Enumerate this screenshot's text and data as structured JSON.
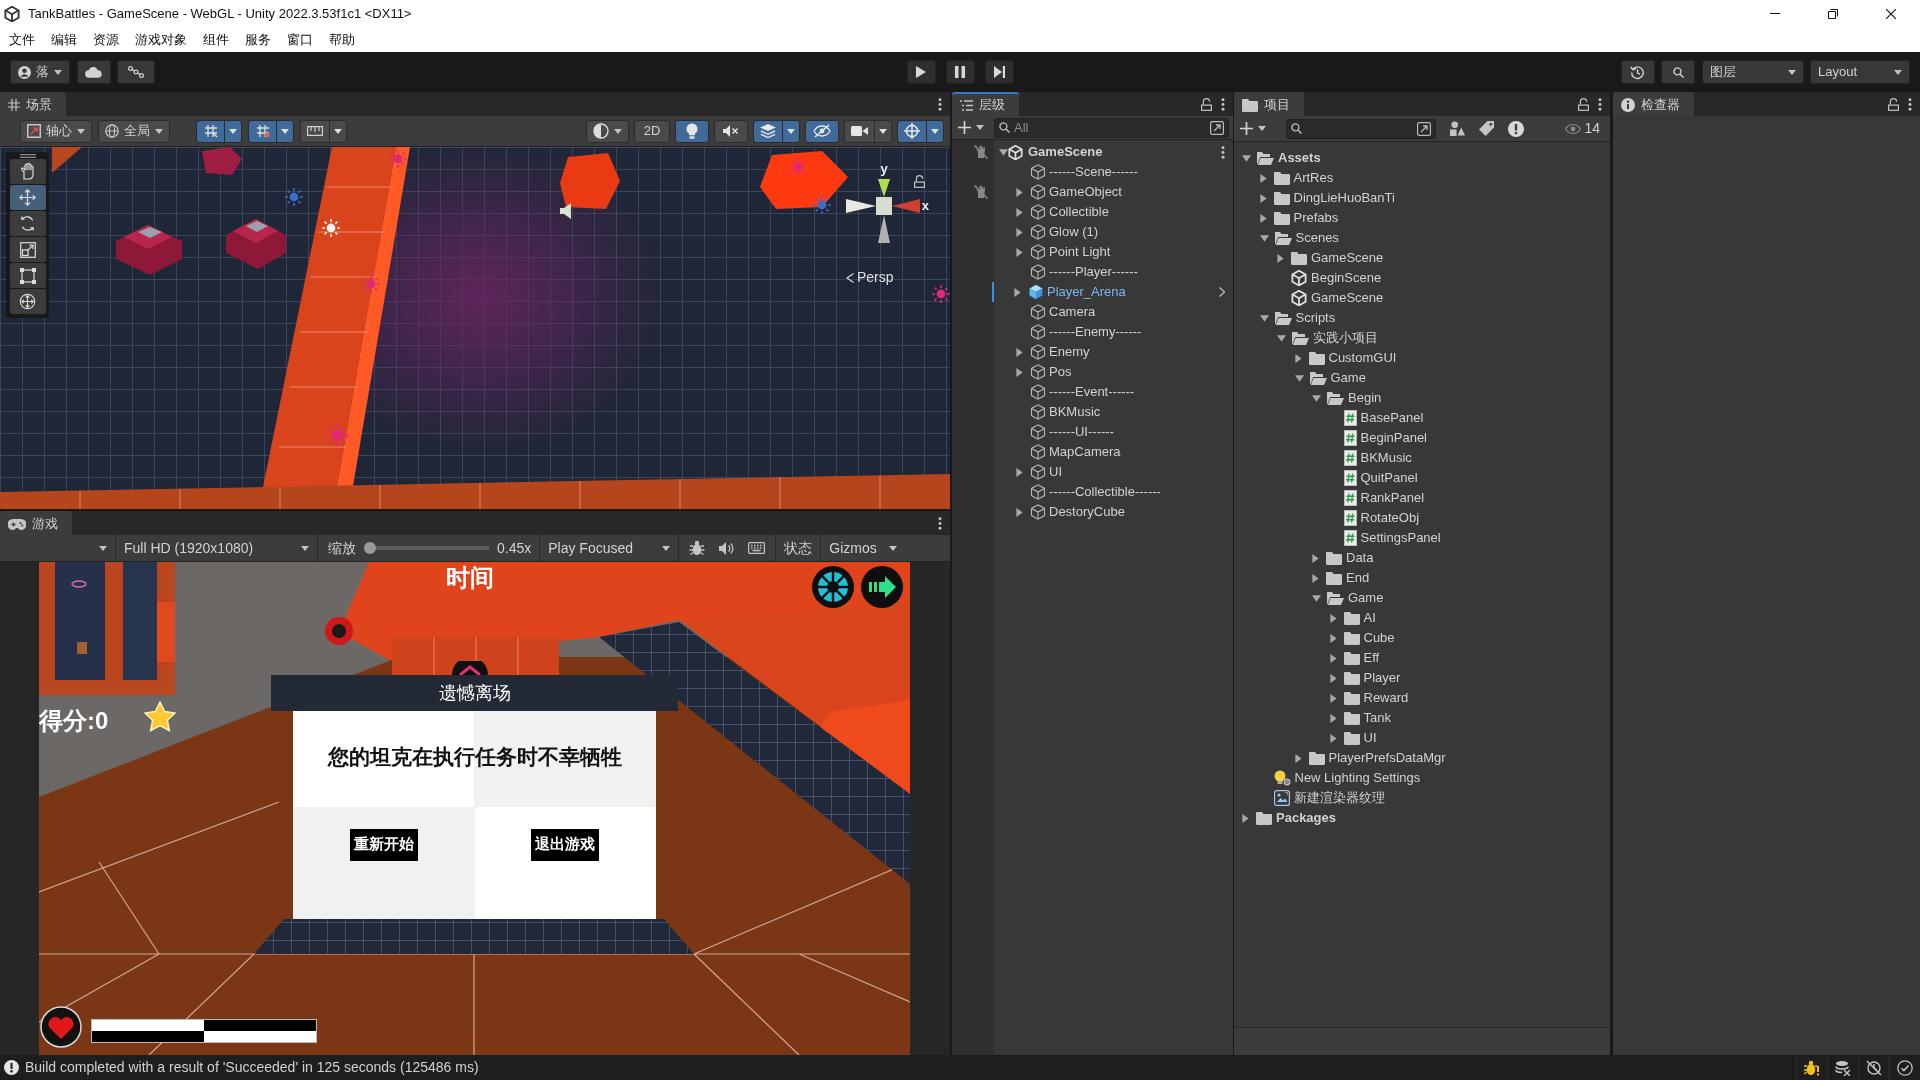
{
  "window": {
    "title": "TankBattles - GameScene - WebGL - Unity 2022.3.53f1c1 <DX11>"
  },
  "menu": [
    "文件",
    "编辑",
    "资源",
    "游戏对象",
    "组件",
    "服务",
    "窗口",
    "帮助"
  ],
  "toolbar": {
    "account": "落",
    "layers": "图层",
    "layout": "Layout"
  },
  "scene_view": {
    "tab": "场景",
    "focused": false,
    "pivot": "轴心",
    "space": "全局",
    "snap_toggles": [
      {
        "kind": "grid_snap",
        "on": true
      },
      {
        "kind": "grid",
        "on": true
      },
      {
        "kind": "increment",
        "on": false
      }
    ],
    "mode_2d": {
      "label": "2D",
      "on": false
    },
    "toggles": [
      {
        "kind": "lighting",
        "on": true
      },
      {
        "kind": "audio",
        "on": false
      },
      {
        "kind": "effects",
        "on": true
      },
      {
        "kind": "visibility",
        "on": true
      },
      {
        "kind": "camera",
        "on": false
      },
      {
        "kind": "gizmos",
        "on": true
      }
    ],
    "tools": [
      {
        "kind": "hand",
        "selected": false
      },
      {
        "kind": "move",
        "selected": true
      },
      {
        "kind": "rotate",
        "selected": false
      },
      {
        "kind": "scale",
        "selected": false
      },
      {
        "kind": "rect",
        "selected": false
      },
      {
        "kind": "transform",
        "selected": false
      }
    ],
    "axes": [
      "y",
      "x"
    ],
    "projection": "Persp"
  },
  "hierarchy": {
    "tab": "层级",
    "focused": true,
    "search_placeholder": "All",
    "scene": {
      "name": "GameScene",
      "expanded": true,
      "pick_disabled": true
    },
    "items": [
      {
        "name": "------Scene------",
        "kind": "object",
        "expandable": false,
        "pick_disabled": false
      },
      {
        "name": "GameObject",
        "kind": "object",
        "expandable": true,
        "pick_disabled": true
      },
      {
        "name": "Collectible",
        "kind": "object",
        "expandable": true,
        "pick_disabled": false
      },
      {
        "name": "Glow (1)",
        "kind": "object",
        "expandable": true,
        "pick_disabled": false
      },
      {
        "name": "Point Light",
        "kind": "object",
        "expandable": true,
        "pick_disabled": false
      },
      {
        "name": "------Player------",
        "kind": "object",
        "expandable": false,
        "pick_disabled": false
      },
      {
        "name": "Player_Arena",
        "kind": "prefab",
        "expandable": true,
        "pick_disabled": false
      },
      {
        "name": "Camera",
        "kind": "object",
        "expandable": false,
        "pick_disabled": false
      },
      {
        "name": "------Enemy------",
        "kind": "object",
        "expandable": false,
        "pick_disabled": false
      },
      {
        "name": "Enemy",
        "kind": "object",
        "expandable": true,
        "pick_disabled": false
      },
      {
        "name": "Pos",
        "kind": "object",
        "expandable": true,
        "pick_disabled": false
      },
      {
        "name": "------Event------",
        "kind": "object",
        "expandable": false,
        "pick_disabled": false
      },
      {
        "name": "BKMusic",
        "kind": "object",
        "expandable": false,
        "pick_disabled": false
      },
      {
        "name": "------UI------",
        "kind": "object",
        "expandable": false,
        "pick_disabled": false
      },
      {
        "name": "MapCamera",
        "kind": "object",
        "expandable": false,
        "pick_disabled": false
      },
      {
        "name": "UI",
        "kind": "object",
        "expandable": true,
        "pick_disabled": false
      },
      {
        "name": "------Collectible------",
        "kind": "object",
        "expandable": false,
        "pick_disabled": false
      },
      {
        "name": "DestoryCube",
        "kind": "object",
        "expandable": true,
        "pick_disabled": false
      }
    ]
  },
  "project": {
    "tab": "项目",
    "focused": false,
    "hidden_count": "14",
    "tree": [
      {
        "name": "Assets",
        "kind": "folder",
        "expanded": true,
        "children": [
          {
            "name": "ArtRes",
            "kind": "folder",
            "expanded": false
          },
          {
            "name": "DingLieHuoBanTi",
            "kind": "folder",
            "expanded": false
          },
          {
            "name": "Prefabs",
            "kind": "folder",
            "expanded": false
          },
          {
            "name": "Scenes",
            "kind": "folder",
            "expanded": true,
            "children": [
              {
                "name": "GameScene",
                "kind": "folder",
                "expanded": false
              },
              {
                "name": "BeginScene",
                "kind": "scene"
              },
              {
                "name": "GameScene",
                "kind": "scene"
              }
            ]
          },
          {
            "name": "Scripts",
            "kind": "folder",
            "expanded": true,
            "children": [
              {
                "name": "实践小项目",
                "kind": "folder",
                "expanded": true,
                "children": [
                  {
                    "name": "CustomGUI",
                    "kind": "folder",
                    "expanded": false
                  },
                  {
                    "name": "Game",
                    "kind": "folder",
                    "expanded": true,
                    "children": [
                      {
                        "name": "Begin",
                        "kind": "folder",
                        "expanded": true,
                        "children": [
                          {
                            "name": "BasePanel",
                            "kind": "script"
                          },
                          {
                            "name": "BeginPanel",
                            "kind": "script"
                          },
                          {
                            "name": "BKMusic",
                            "kind": "script"
                          },
                          {
                            "name": "QuitPanel",
                            "kind": "script"
                          },
                          {
                            "name": "RankPanel",
                            "kind": "script"
                          },
                          {
                            "name": "RotateObj",
                            "kind": "script"
                          },
                          {
                            "name": "SettingsPanel",
                            "kind": "script"
                          }
                        ]
                      },
                      {
                        "name": "Data",
                        "kind": "folder",
                        "expanded": false
                      },
                      {
                        "name": "End",
                        "kind": "folder",
                        "expanded": false
                      },
                      {
                        "name": "Game",
                        "kind": "folder",
                        "expanded": true,
                        "children": [
                          {
                            "name": "AI",
                            "kind": "folder",
                            "expanded": false
                          },
                          {
                            "name": "Cube",
                            "kind": "folder",
                            "expanded": false
                          },
                          {
                            "name": "Eff",
                            "kind": "folder",
                            "expanded": false
                          },
                          {
                            "name": "Player",
                            "kind": "folder",
                            "expanded": false
                          },
                          {
                            "name": "Reward",
                            "kind": "folder",
                            "expanded": false
                          },
                          {
                            "name": "Tank",
                            "kind": "folder",
                            "expanded": false
                          },
                          {
                            "name": "UI",
                            "kind": "folder",
                            "expanded": false
                          }
                        ]
                      }
                    ]
                  },
                  {
                    "name": "PlayerPrefsDataMgr",
                    "kind": "folder",
                    "expanded": false
                  }
                ]
              }
            ]
          },
          {
            "name": "New Lighting Settings",
            "kind": "lighting"
          },
          {
            "name": "新建渲染器纹理",
            "kind": "render_texture"
          }
        ]
      },
      {
        "name": "Packages",
        "kind": "folder",
        "expanded": false
      }
    ]
  },
  "inspector": {
    "tab": "检查器",
    "focused": false
  },
  "game_view": {
    "tab": "游戏",
    "focused": false,
    "resolution": "Full HD (1920x1080)",
    "scale_label": "缩放",
    "scale": {
      "level": 0,
      "reading": "0.45x"
    },
    "play_mode": "Play Focused",
    "stats": "状态",
    "gizmos": "Gizmos",
    "hud": {
      "time_label": "时间",
      "score": "得分:0",
      "health": {
        "level": 0.5
      }
    },
    "dialog": {
      "title": "遗憾离场",
      "message": "您的坦克在执行任务时不幸牺牲",
      "buttons": [
        "重新开始",
        "退出游戏"
      ]
    }
  },
  "status_bar": {
    "message": "Build completed with a result of 'Succeeded' in 125 seconds (125486 ms)"
  }
}
